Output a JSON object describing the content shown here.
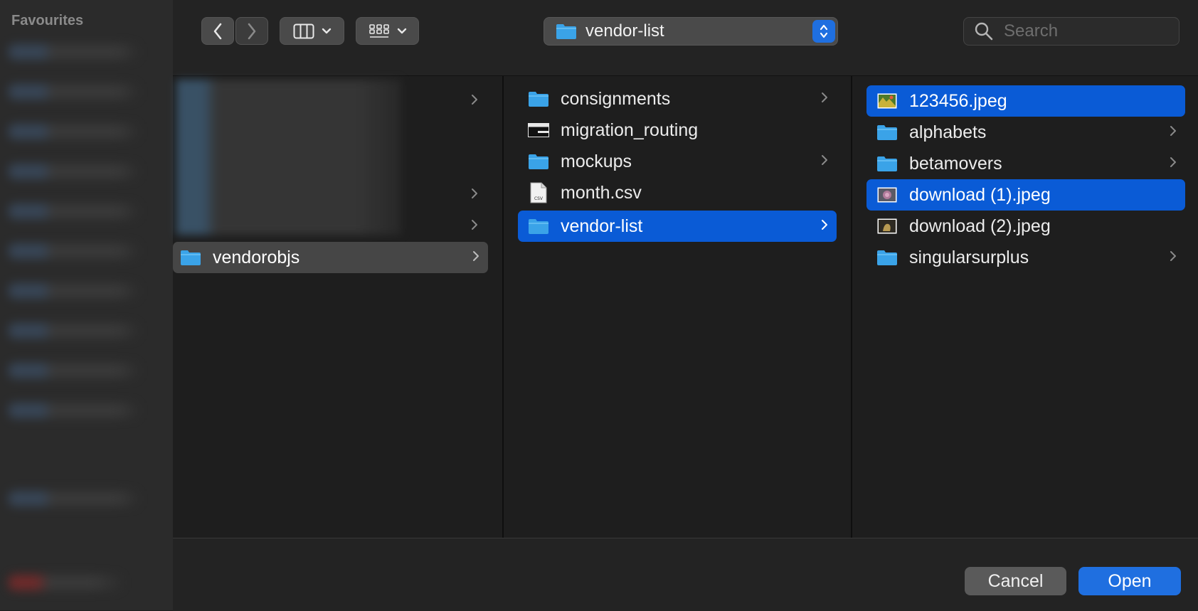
{
  "sidebar": {
    "title": "Favourites"
  },
  "toolbar": {
    "back_icon": "chevron-left-icon",
    "forward_icon": "chevron-right-icon",
    "view_mode_icon": "column-view-icon",
    "group_icon": "grid-icon",
    "path": {
      "label": "vendor-list"
    },
    "search": {
      "placeholder": "Search",
      "value": ""
    }
  },
  "columns": {
    "col1": {
      "items": [
        {
          "name": "vendorobjs",
          "type": "folder",
          "selected": true
        }
      ]
    },
    "col2": {
      "items": [
        {
          "name": "consignments",
          "type": "folder",
          "has_children": true
        },
        {
          "name": "migration_routing",
          "type": "executable",
          "has_children": false
        },
        {
          "name": "mockups",
          "type": "folder",
          "has_children": true
        },
        {
          "name": "month.csv",
          "type": "csv",
          "has_children": false
        },
        {
          "name": "vendor-list",
          "type": "folder",
          "has_children": true,
          "selected": true
        }
      ]
    },
    "col3": {
      "items": [
        {
          "name": "123456.jpeg",
          "type": "image",
          "selected": true
        },
        {
          "name": "alphabets",
          "type": "folder",
          "has_children": true
        },
        {
          "name": "betamovers",
          "type": "folder",
          "has_children": true
        },
        {
          "name": "download (1).jpeg",
          "type": "image",
          "selected": true
        },
        {
          "name": "download (2).jpeg",
          "type": "image"
        },
        {
          "name": "singularsurplus",
          "type": "folder",
          "has_children": true
        }
      ]
    }
  },
  "buttons": {
    "cancel": "Cancel",
    "open": "Open"
  },
  "colors": {
    "accent": "#0a5bd6",
    "folder": "#3aa3e8"
  }
}
